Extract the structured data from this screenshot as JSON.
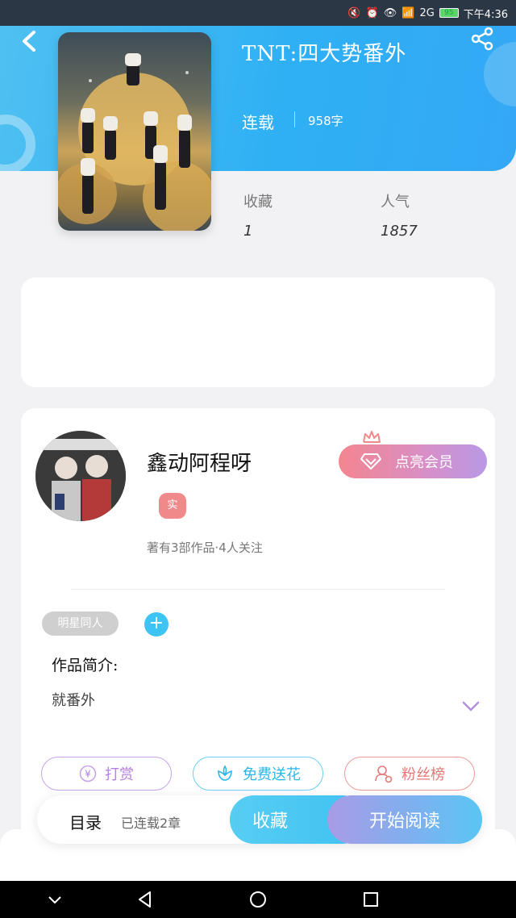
{
  "status_bar": {
    "network": "2G",
    "battery": "95",
    "time": "下午4:36"
  },
  "book": {
    "title": "TNT:四大势番外",
    "status": "连载",
    "word_count": "958字",
    "stats": {
      "favorites_label": "收藏",
      "favorites_value": "1",
      "popularity_label": "人气",
      "popularity_value": "1857"
    }
  },
  "author": {
    "name": "鑫动阿程呀",
    "real_badge": "实",
    "meta": "著有3部作品·4人关注",
    "vip_button": "点亮会员"
  },
  "tags": [
    "明星同人"
  ],
  "intro": {
    "title": "作品简介:",
    "text": "就番外"
  },
  "actions": {
    "reward": "打赏",
    "free_flower": "免费送花",
    "fans_rank": "粉丝榜"
  },
  "bottom_bar": {
    "toc_label": "目录",
    "toc_count": "已连载2章",
    "collect": "收藏",
    "start_reading": "开始阅读"
  },
  "colors": {
    "header_blue": "#2fb0f4",
    "accent_cyan": "#3ec4f4",
    "accent_purple": "#b57fe3",
    "accent_red": "#e67878"
  }
}
